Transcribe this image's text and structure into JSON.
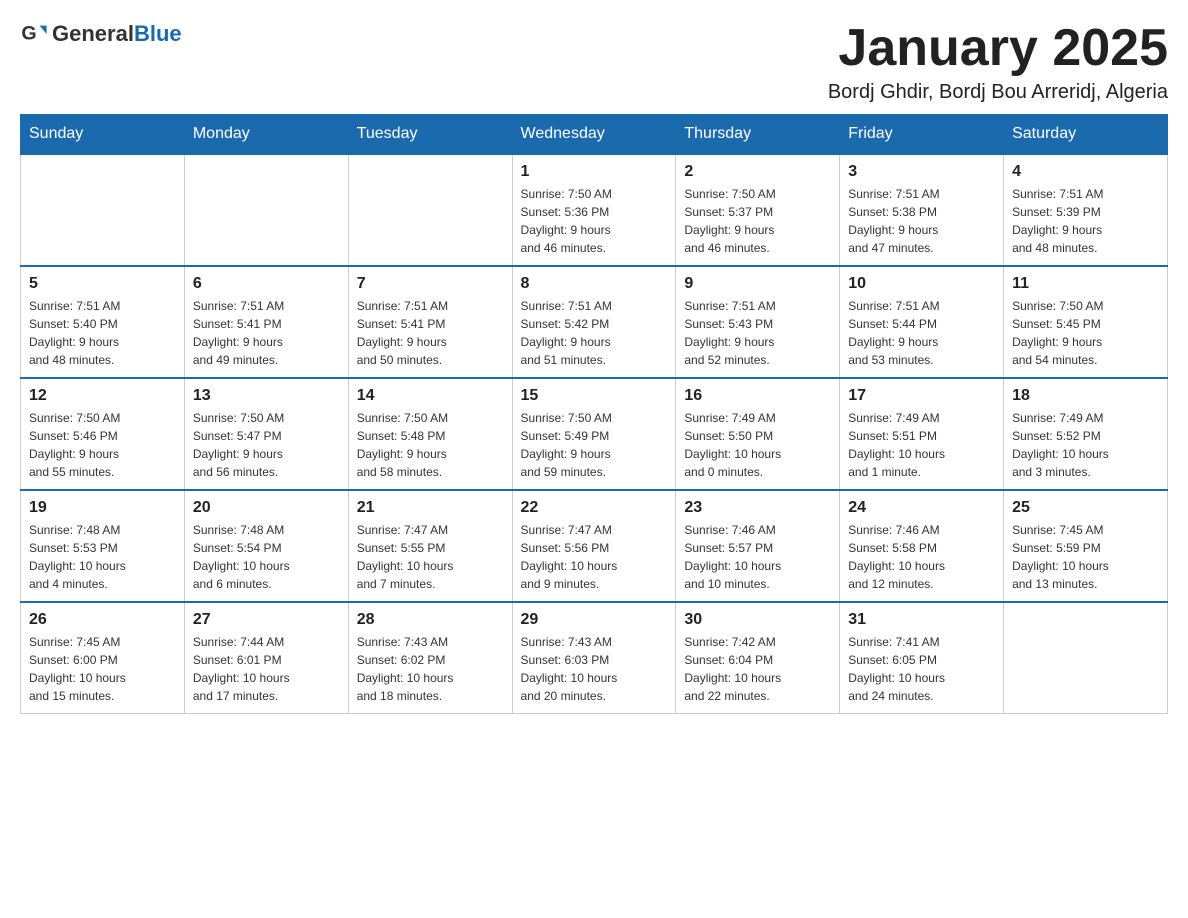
{
  "header": {
    "logo_general": "General",
    "logo_blue": "Blue",
    "title": "January 2025",
    "subtitle": "Bordj Ghdir, Bordj Bou Arreridj, Algeria"
  },
  "weekdays": [
    "Sunday",
    "Monday",
    "Tuesday",
    "Wednesday",
    "Thursday",
    "Friday",
    "Saturday"
  ],
  "weeks": [
    [
      {
        "day": "",
        "info": ""
      },
      {
        "day": "",
        "info": ""
      },
      {
        "day": "",
        "info": ""
      },
      {
        "day": "1",
        "info": "Sunrise: 7:50 AM\nSunset: 5:36 PM\nDaylight: 9 hours\nand 46 minutes."
      },
      {
        "day": "2",
        "info": "Sunrise: 7:50 AM\nSunset: 5:37 PM\nDaylight: 9 hours\nand 46 minutes."
      },
      {
        "day": "3",
        "info": "Sunrise: 7:51 AM\nSunset: 5:38 PM\nDaylight: 9 hours\nand 47 minutes."
      },
      {
        "day": "4",
        "info": "Sunrise: 7:51 AM\nSunset: 5:39 PM\nDaylight: 9 hours\nand 48 minutes."
      }
    ],
    [
      {
        "day": "5",
        "info": "Sunrise: 7:51 AM\nSunset: 5:40 PM\nDaylight: 9 hours\nand 48 minutes."
      },
      {
        "day": "6",
        "info": "Sunrise: 7:51 AM\nSunset: 5:41 PM\nDaylight: 9 hours\nand 49 minutes."
      },
      {
        "day": "7",
        "info": "Sunrise: 7:51 AM\nSunset: 5:41 PM\nDaylight: 9 hours\nand 50 minutes."
      },
      {
        "day": "8",
        "info": "Sunrise: 7:51 AM\nSunset: 5:42 PM\nDaylight: 9 hours\nand 51 minutes."
      },
      {
        "day": "9",
        "info": "Sunrise: 7:51 AM\nSunset: 5:43 PM\nDaylight: 9 hours\nand 52 minutes."
      },
      {
        "day": "10",
        "info": "Sunrise: 7:51 AM\nSunset: 5:44 PM\nDaylight: 9 hours\nand 53 minutes."
      },
      {
        "day": "11",
        "info": "Sunrise: 7:50 AM\nSunset: 5:45 PM\nDaylight: 9 hours\nand 54 minutes."
      }
    ],
    [
      {
        "day": "12",
        "info": "Sunrise: 7:50 AM\nSunset: 5:46 PM\nDaylight: 9 hours\nand 55 minutes."
      },
      {
        "day": "13",
        "info": "Sunrise: 7:50 AM\nSunset: 5:47 PM\nDaylight: 9 hours\nand 56 minutes."
      },
      {
        "day": "14",
        "info": "Sunrise: 7:50 AM\nSunset: 5:48 PM\nDaylight: 9 hours\nand 58 minutes."
      },
      {
        "day": "15",
        "info": "Sunrise: 7:50 AM\nSunset: 5:49 PM\nDaylight: 9 hours\nand 59 minutes."
      },
      {
        "day": "16",
        "info": "Sunrise: 7:49 AM\nSunset: 5:50 PM\nDaylight: 10 hours\nand 0 minutes."
      },
      {
        "day": "17",
        "info": "Sunrise: 7:49 AM\nSunset: 5:51 PM\nDaylight: 10 hours\nand 1 minute."
      },
      {
        "day": "18",
        "info": "Sunrise: 7:49 AM\nSunset: 5:52 PM\nDaylight: 10 hours\nand 3 minutes."
      }
    ],
    [
      {
        "day": "19",
        "info": "Sunrise: 7:48 AM\nSunset: 5:53 PM\nDaylight: 10 hours\nand 4 minutes."
      },
      {
        "day": "20",
        "info": "Sunrise: 7:48 AM\nSunset: 5:54 PM\nDaylight: 10 hours\nand 6 minutes."
      },
      {
        "day": "21",
        "info": "Sunrise: 7:47 AM\nSunset: 5:55 PM\nDaylight: 10 hours\nand 7 minutes."
      },
      {
        "day": "22",
        "info": "Sunrise: 7:47 AM\nSunset: 5:56 PM\nDaylight: 10 hours\nand 9 minutes."
      },
      {
        "day": "23",
        "info": "Sunrise: 7:46 AM\nSunset: 5:57 PM\nDaylight: 10 hours\nand 10 minutes."
      },
      {
        "day": "24",
        "info": "Sunrise: 7:46 AM\nSunset: 5:58 PM\nDaylight: 10 hours\nand 12 minutes."
      },
      {
        "day": "25",
        "info": "Sunrise: 7:45 AM\nSunset: 5:59 PM\nDaylight: 10 hours\nand 13 minutes."
      }
    ],
    [
      {
        "day": "26",
        "info": "Sunrise: 7:45 AM\nSunset: 6:00 PM\nDaylight: 10 hours\nand 15 minutes."
      },
      {
        "day": "27",
        "info": "Sunrise: 7:44 AM\nSunset: 6:01 PM\nDaylight: 10 hours\nand 17 minutes."
      },
      {
        "day": "28",
        "info": "Sunrise: 7:43 AM\nSunset: 6:02 PM\nDaylight: 10 hours\nand 18 minutes."
      },
      {
        "day": "29",
        "info": "Sunrise: 7:43 AM\nSunset: 6:03 PM\nDaylight: 10 hours\nand 20 minutes."
      },
      {
        "day": "30",
        "info": "Sunrise: 7:42 AM\nSunset: 6:04 PM\nDaylight: 10 hours\nand 22 minutes."
      },
      {
        "day": "31",
        "info": "Sunrise: 7:41 AM\nSunset: 6:05 PM\nDaylight: 10 hours\nand 24 minutes."
      },
      {
        "day": "",
        "info": ""
      }
    ]
  ]
}
